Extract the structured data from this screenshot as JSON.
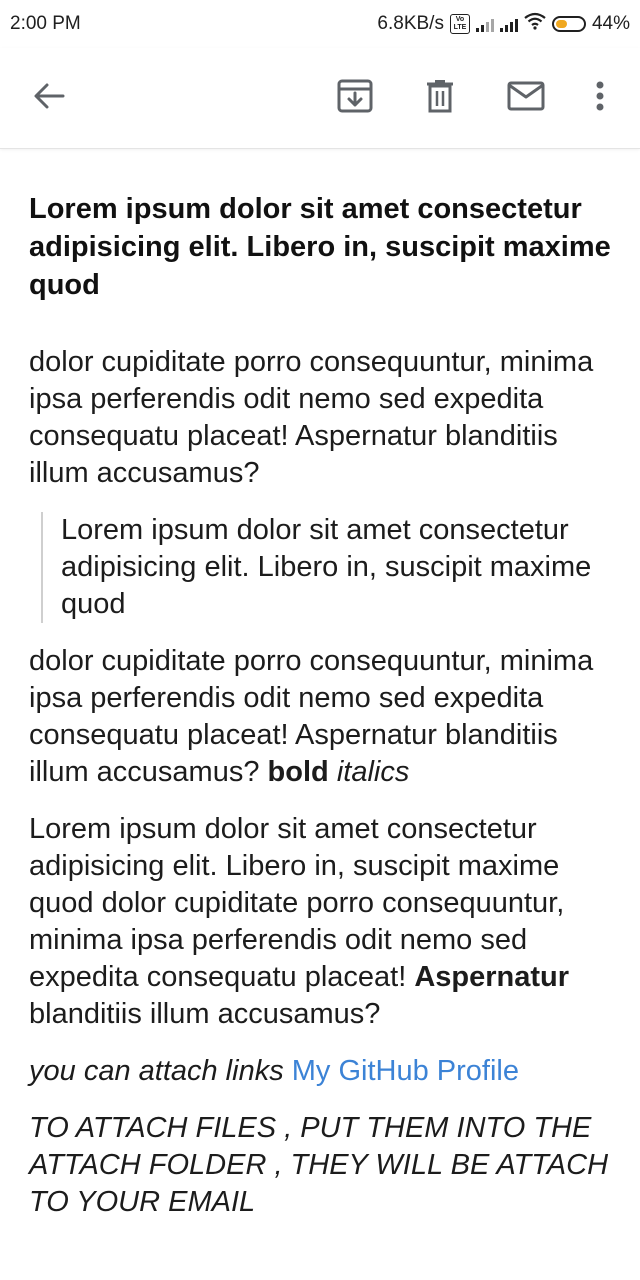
{
  "status_bar": {
    "time": "2:00 PM",
    "net_speed": "6.8KB/s",
    "volte": "Vo LTE",
    "battery_percent": "44%",
    "battery_level": 0.44,
    "battery_color": "#f0a820"
  },
  "toolbar": {
    "back_icon": "arrow-left-icon",
    "archive_icon": "archive-icon",
    "delete_icon": "trash-icon",
    "mark_icon": "mail-icon",
    "more_icon": "more-vert-icon"
  },
  "email": {
    "subject": "Lorem ipsum dolor sit amet consectetur adipisicing elit. Libero in, suscipit maxime quod",
    "para1": "dolor cupiditate porro consequuntur, minima ipsa perferendis odit nemo sed expedita consequatu placeat! Aspernatur blanditiis illum accusamus?",
    "quote": "Lorem ipsum dolor sit amet consectetur adipisicing elit. Libero in, suscipit maxime quod",
    "para2": "dolor cupiditate porro consequuntur, minima ipsa perferendis odit nemo sed expedita consequatu placeat! Aspernatur blanditiis illum accusamus?",
    "bold_word": "bold",
    "italic_word": "italics",
    "para3_start": "Lorem ipsum dolor sit amet consectetur adipisicing elit. Libero in, suscipit maxime quod dolor cupiditate porro consequuntur, minima ipsa perferendis odit nemo sed expedita consequatu placeat!",
    "para3_bold": "Aspernatur",
    "para3_end": "blanditiis illum accusamus?",
    "link_intro": "you can attach links",
    "link_text": "My GitHub Profile",
    "link_color": "#3c83d6",
    "attach_note": "TO ATTACH FILES , PUT THEM INTO THE ATTACH FOLDER , THEY WILL BE ATTACH TO YOUR EMAIL"
  }
}
